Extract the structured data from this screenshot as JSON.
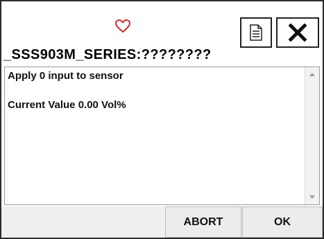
{
  "dialog": {
    "title": "_SSS903M_SERIES:????????",
    "heart_icon": "heart-outline-icon",
    "heart_color": "#d6282b",
    "doc_icon": "document-icon",
    "close_icon": "close-icon",
    "message_line1": "Apply 0 input to sensor",
    "message_line2": "Current Value  0.00 Vol%",
    "abort_label": "ABORT",
    "ok_label": "OK"
  }
}
